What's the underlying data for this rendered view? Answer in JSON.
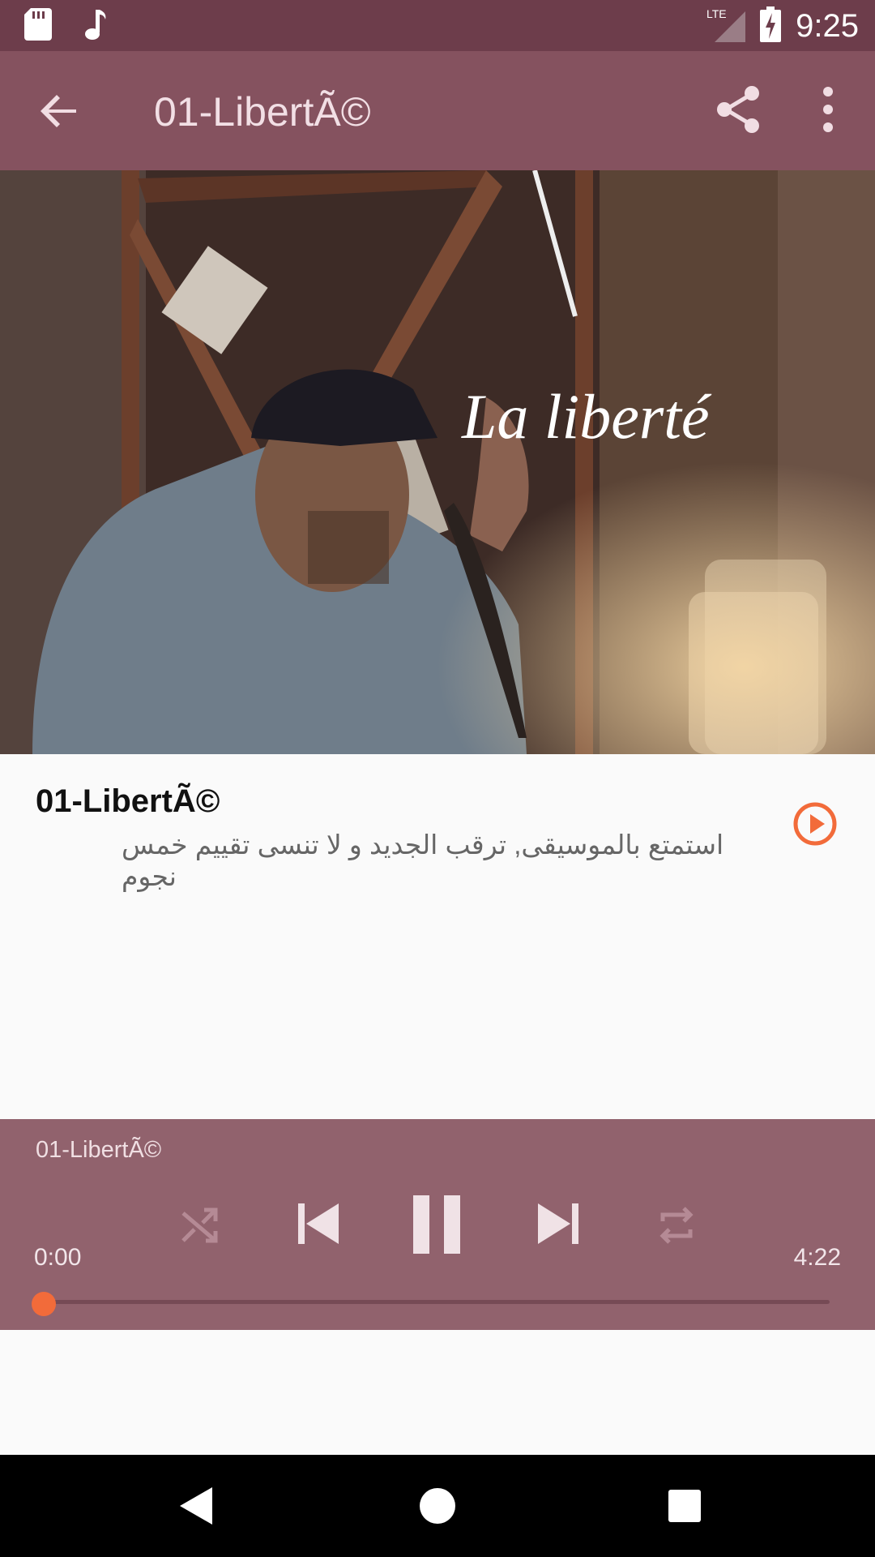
{
  "status": {
    "network": "LTE",
    "time": "9:25"
  },
  "app_bar": {
    "title": "01-LibertÃ©"
  },
  "artwork": {
    "overlay_text": "La liberté"
  },
  "track_info": {
    "title": "01-LibertÃ©",
    "description": "استمتع بالموسيقى, ترقب الجديد و لا تنسى تقييم خمس نجوم"
  },
  "player": {
    "title": "01-LibertÃ©",
    "current_time": "0:00",
    "total_time": "4:22",
    "progress_fraction": 0.0
  },
  "colors": {
    "status_bar": "#6d3d4b",
    "app_bar": "#85525f",
    "player_bg": "#91626d",
    "accent": "#f26b3a"
  }
}
